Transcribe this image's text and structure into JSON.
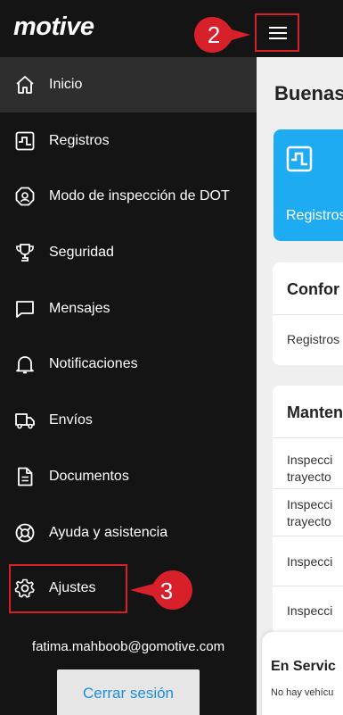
{
  "app": {
    "logo_text": "motive",
    "menu_button": "menu"
  },
  "sidebar": {
    "items": [
      {
        "label": "Inicio",
        "icon": "home-icon",
        "active": true
      },
      {
        "label": "Registros",
        "icon": "logs-icon"
      },
      {
        "label": "Modo de inspección de DOT",
        "icon": "badge-icon"
      },
      {
        "label": "Seguridad",
        "icon": "trophy-icon"
      },
      {
        "label": "Mensajes",
        "icon": "message-icon"
      },
      {
        "label": "Notificaciones",
        "icon": "bell-icon"
      },
      {
        "label": "Envíos",
        "icon": "truck-icon"
      },
      {
        "label": "Documentos",
        "icon": "document-icon"
      },
      {
        "label": "Ayuda y asistencia",
        "icon": "lifebuoy-icon"
      },
      {
        "label": "Ajustes",
        "icon": "gear-icon"
      }
    ],
    "email": "fatima.mahboob@gomotive.com",
    "logout_label": "Cerrar sesión"
  },
  "main": {
    "greeting": "Buenas",
    "quick_card_label": "Registros",
    "card1": {
      "title": "Confor",
      "row": "Registros"
    },
    "card2": {
      "title": "Manten",
      "rows": [
        "Inspecci",
        "trayecto",
        "Inspecci",
        "trayecto",
        "Inspecci",
        "Inspecci"
      ]
    },
    "bottom_card": {
      "title": "En Servic",
      "subtitle": "No hay vehícu"
    }
  },
  "annotations": {
    "step_hamburger": "2",
    "step_settings": "3",
    "highlight_color": "#d8202b"
  },
  "colors": {
    "drawer_bg": "#141414",
    "active_item_bg": "#2e2e2e",
    "accent_blue": "#1eabf1",
    "link_blue": "#1c8fe0"
  }
}
